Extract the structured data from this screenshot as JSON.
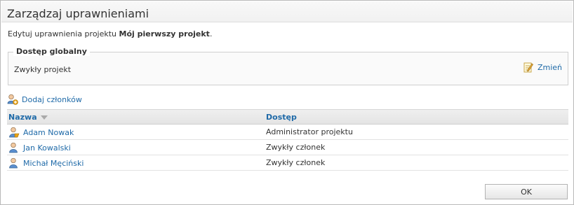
{
  "dialog": {
    "title": "Zarządzaj uprawnieniami",
    "intro_prefix": "Edytuj uprawnienia projektu ",
    "project_name": "Mój pierwszy projekt",
    "intro_suffix": "."
  },
  "global_access": {
    "legend": "Dostęp globalny",
    "value": "Zwykły projekt",
    "change_label": "Zmień",
    "change_icon": "edit-note-icon"
  },
  "add_members": {
    "label": "Dodaj członków",
    "icon": "add-user-icon"
  },
  "table": {
    "columns": [
      "Nazwa",
      "Dostęp"
    ],
    "sort": {
      "column": "Nazwa",
      "direction": "descending"
    },
    "rows": [
      {
        "name": "Adam Nowak",
        "access": "Administrator projektu",
        "icon": "admin-user-icon"
      },
      {
        "name": "Jan Kowalski",
        "access": "Zwykły członek",
        "icon": "user-icon"
      },
      {
        "name": "Michał Męciński",
        "access": "Zwykły członek",
        "icon": "user-icon"
      }
    ]
  },
  "buttons": {
    "ok": "OK"
  },
  "colors": {
    "link": "#1f6aa8",
    "text": "#333333",
    "border": "#b9b9b9"
  }
}
